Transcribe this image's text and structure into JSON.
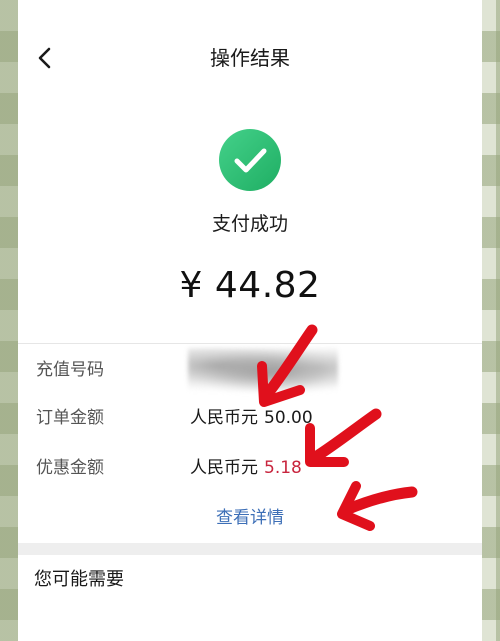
{
  "navbar": {
    "back_icon": "chevron-left-icon",
    "title": "操作结果"
  },
  "result": {
    "icon": "check-circle-icon",
    "icon_color": "#2dbf72",
    "status": "支付成功",
    "amount": "¥ 44.82"
  },
  "details": {
    "rows": [
      {
        "label": "充值号码",
        "value": ""
      },
      {
        "label": "订单金额",
        "currency": "人民币元",
        "amount": "50.00"
      },
      {
        "label": "优惠金额",
        "currency": "人民币元",
        "amount": "5.18"
      }
    ],
    "link": "查看详情",
    "link_color": "#3d6fb7",
    "discount_color": "#c8253e"
  },
  "recommend": {
    "title": "您可能需要"
  },
  "annotations": {
    "arrow_color": "#e0101c"
  }
}
